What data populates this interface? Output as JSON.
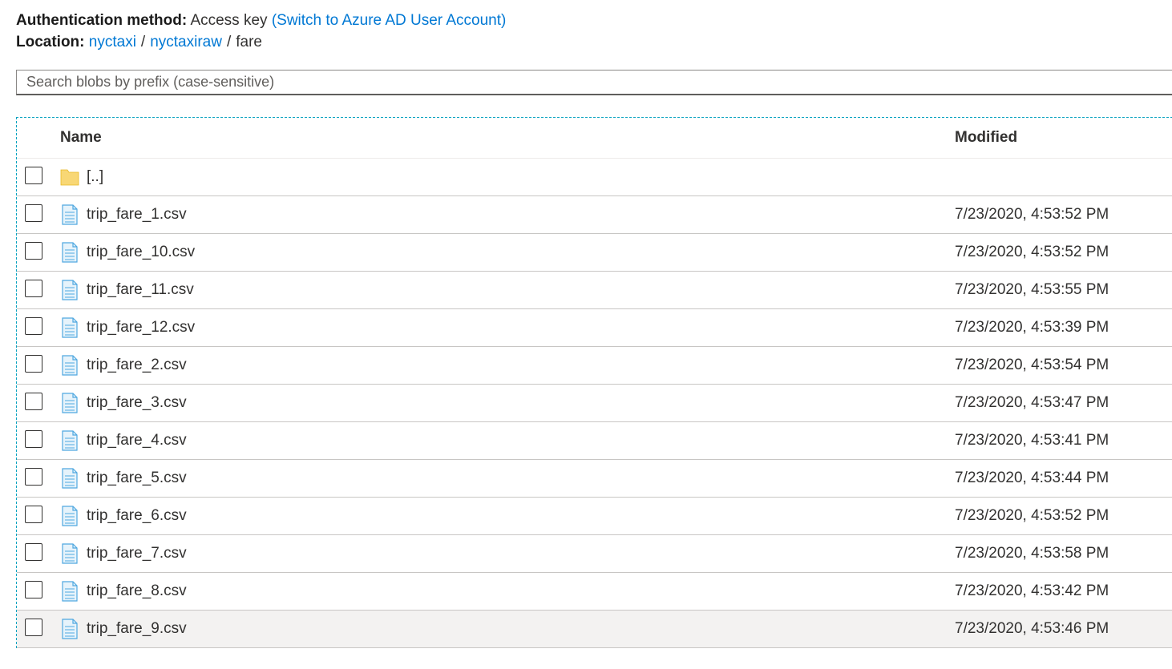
{
  "info": {
    "auth_label": "Authentication method:",
    "auth_value": "Access key",
    "auth_switch_link": "(Switch to Azure AD User Account)",
    "location_label": "Location:",
    "breadcrumb": [
      "nyctaxi",
      "nyctaxiraw",
      "fare"
    ],
    "breadcrumb_sep": "/"
  },
  "search": {
    "placeholder": "Search blobs by prefix (case-sensitive)",
    "value": ""
  },
  "table": {
    "columns": [
      "Name",
      "Modified"
    ],
    "parent_folder": {
      "name": "[..]",
      "icon": "folder-icon"
    },
    "rows": [
      {
        "name": "trip_fare_1.csv",
        "modified": "7/23/2020, 4:53:52 PM"
      },
      {
        "name": "trip_fare_10.csv",
        "modified": "7/23/2020, 4:53:52 PM"
      },
      {
        "name": "trip_fare_11.csv",
        "modified": "7/23/2020, 4:53:55 PM"
      },
      {
        "name": "trip_fare_12.csv",
        "modified": "7/23/2020, 4:53:39 PM"
      },
      {
        "name": "trip_fare_2.csv",
        "modified": "7/23/2020, 4:53:54 PM"
      },
      {
        "name": "trip_fare_3.csv",
        "modified": "7/23/2020, 4:53:47 PM"
      },
      {
        "name": "trip_fare_4.csv",
        "modified": "7/23/2020, 4:53:41 PM"
      },
      {
        "name": "trip_fare_5.csv",
        "modified": "7/23/2020, 4:53:44 PM"
      },
      {
        "name": "trip_fare_6.csv",
        "modified": "7/23/2020, 4:53:52 PM"
      },
      {
        "name": "trip_fare_7.csv",
        "modified": "7/23/2020, 4:53:58 PM"
      },
      {
        "name": "trip_fare_8.csv",
        "modified": "7/23/2020, 4:53:42 PM"
      },
      {
        "name": "trip_fare_9.csv",
        "modified": "7/23/2020, 4:53:46 PM"
      }
    ],
    "file_icon": "file-document-icon",
    "hovered_row": "trip_fare_9.csv"
  },
  "colors": {
    "link": "#0078d4",
    "folder": "#f8d775",
    "file_icon": "#4fa8e0",
    "grid_focus_border": "#0aa2c0",
    "hover_row": "#f3f2f1"
  }
}
